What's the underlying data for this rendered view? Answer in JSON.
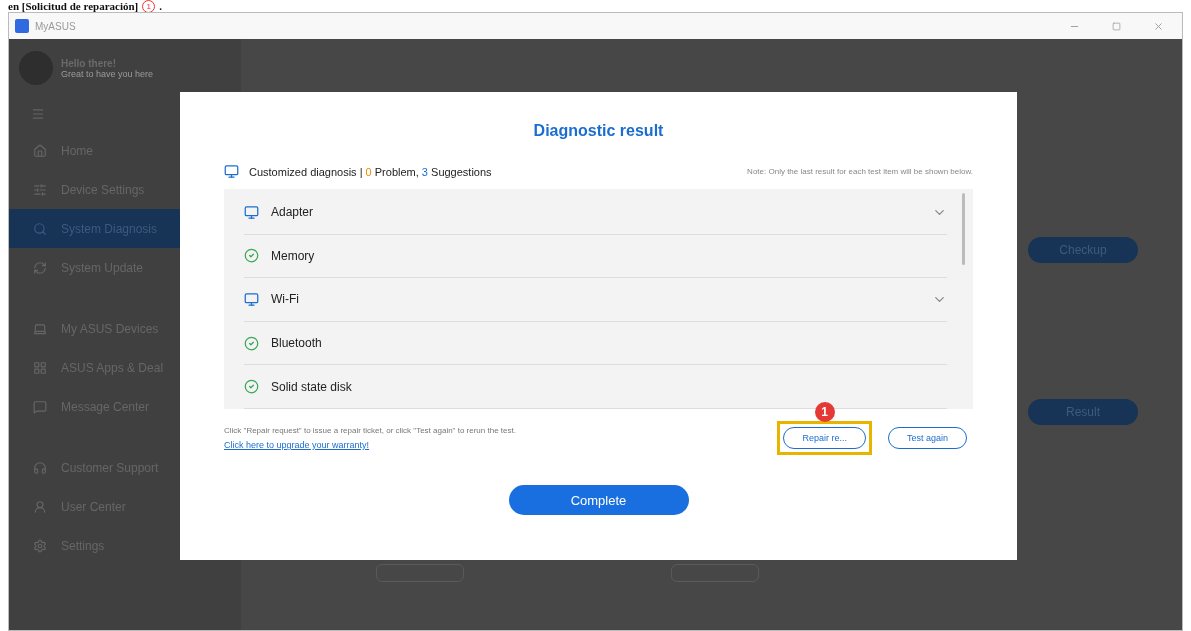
{
  "caption": {
    "text": "en [Solicitud de reparación]",
    "marker": "1",
    "end": "."
  },
  "window": {
    "title": "MyASUS"
  },
  "sidebar": {
    "greeting": "Hello there!",
    "subtitle": "Great to have you here",
    "items": [
      {
        "label": "Home",
        "selected": false
      },
      {
        "label": "Device Settings",
        "selected": false
      },
      {
        "label": "System Diagnosis",
        "selected": true
      },
      {
        "label": "System Update",
        "selected": false
      },
      {
        "label": "My ASUS Devices",
        "selected": false
      },
      {
        "label": "ASUS Apps & Deal",
        "selected": false
      },
      {
        "label": "Message Center",
        "selected": false
      },
      {
        "label": "Customer Support",
        "selected": false
      },
      {
        "label": "User Center",
        "selected": false
      },
      {
        "label": "Settings",
        "selected": false
      }
    ]
  },
  "background": {
    "buttons": [
      "Checkup",
      "Result"
    ]
  },
  "dialog": {
    "title": "Diagnostic result",
    "summary": {
      "label": "Customized diagnosis |",
      "problem_count": "0",
      "problem_label": "Problem,",
      "suggestion_count": "3",
      "suggestion_label": "Suggestions"
    },
    "note": "Note: Only the last result for each test item will be shown below.",
    "items": [
      {
        "label": "Adapter",
        "kind": "suggestion"
      },
      {
        "label": "Memory",
        "kind": "passed"
      },
      {
        "label": "Wi-Fi",
        "kind": "suggestion"
      },
      {
        "label": "Bluetooth",
        "kind": "passed"
      },
      {
        "label": "Solid state disk",
        "kind": "passed"
      }
    ],
    "hint": "Click \"Repair request\" to issue a repair ticket, or click \"Test again\" to rerun the test.",
    "link": "Click here to upgrade your warranty!",
    "buttons": [
      {
        "label": "Repair re...",
        "highlighted": true,
        "marker": "1"
      },
      {
        "label": "Test again",
        "highlighted": false
      }
    ],
    "complete": "Complete"
  }
}
